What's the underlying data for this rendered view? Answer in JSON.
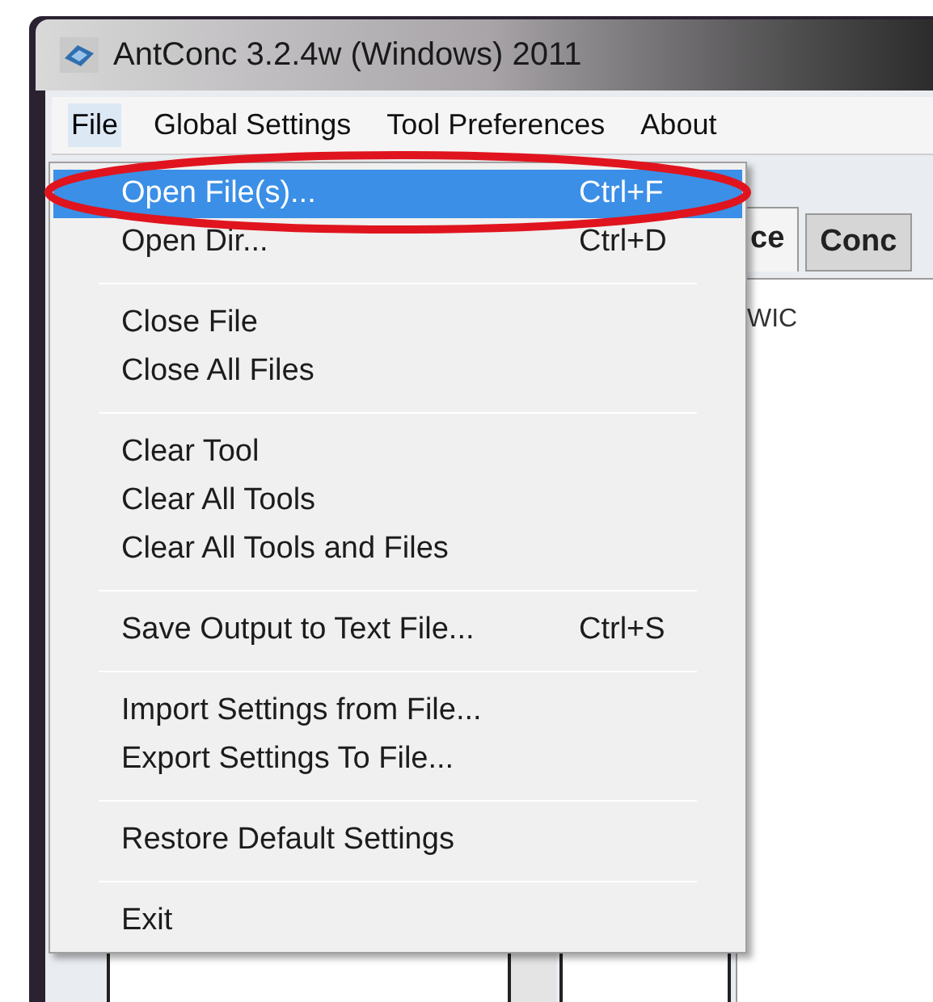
{
  "window": {
    "title": "AntConc 3.2.4w (Windows) 2011"
  },
  "menu_bar": [
    {
      "label": "File",
      "selected": true
    },
    {
      "label": "Global Settings",
      "selected": false
    },
    {
      "label": "Tool Preferences",
      "selected": false
    },
    {
      "label": "About",
      "selected": false
    }
  ],
  "file_menu": [
    {
      "kind": "item",
      "label": "Open File(s)...",
      "shortcut": "Ctrl+F",
      "selected": true
    },
    {
      "kind": "item",
      "label": "Open Dir...",
      "shortcut": "Ctrl+D",
      "selected": false
    },
    {
      "kind": "separator"
    },
    {
      "kind": "item",
      "label": "Close File",
      "selected": false
    },
    {
      "kind": "item",
      "label": "Close All Files",
      "selected": false
    },
    {
      "kind": "separator"
    },
    {
      "kind": "item",
      "label": "Clear Tool",
      "selected": false
    },
    {
      "kind": "item",
      "label": "Clear All Tools",
      "selected": false
    },
    {
      "kind": "item",
      "label": "Clear All Tools and Files",
      "selected": false
    },
    {
      "kind": "separator"
    },
    {
      "kind": "item",
      "label": "Save Output to Text File...",
      "shortcut": "Ctrl+S",
      "selected": false
    },
    {
      "kind": "separator"
    },
    {
      "kind": "item",
      "label": "Import Settings from File...",
      "selected": false
    },
    {
      "kind": "item",
      "label": "Export Settings To File...",
      "selected": false
    },
    {
      "kind": "separator"
    },
    {
      "kind": "item",
      "label": "Restore Default Settings",
      "selected": false
    },
    {
      "kind": "separator"
    },
    {
      "kind": "item",
      "label": "Exit",
      "selected": false
    }
  ],
  "tabs": [
    {
      "label": "ce",
      "selected": true
    },
    {
      "label": "Conc",
      "selected": false
    }
  ],
  "kwic_header": "WIC"
}
